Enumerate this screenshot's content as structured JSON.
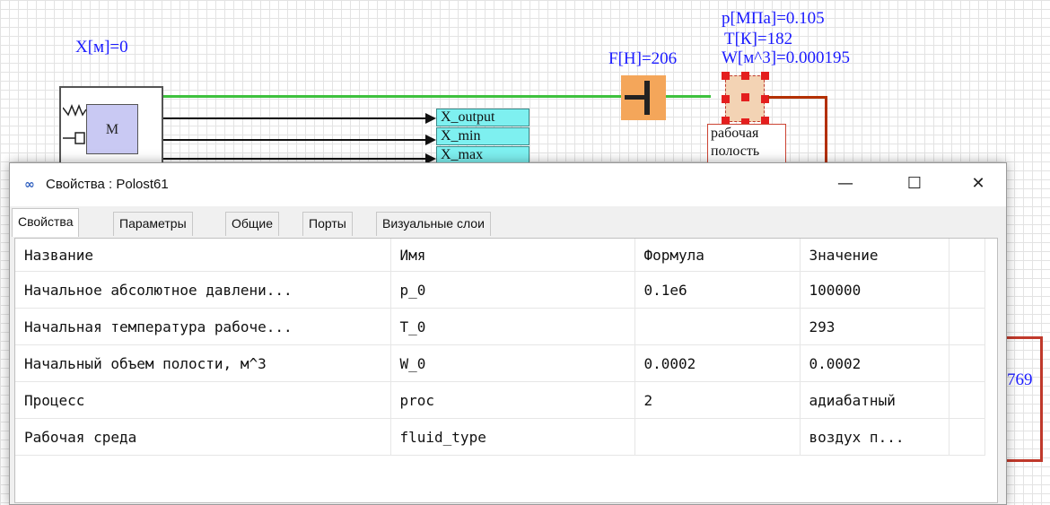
{
  "diagram": {
    "x_label": "X[м]=0",
    "force_label": "F[H]=206",
    "pressure_label": "p[МПа]=0.105",
    "temp_label": "T[К]=182",
    "volume_label": "W[м^3]=0.000195",
    "mass_label": "M",
    "outputs": [
      "X_output",
      "X_min",
      "X_max"
    ],
    "cavity_caption": "рабочая полость",
    "partial_value": "769"
  },
  "window": {
    "title": "Свойства : Polost61",
    "minimize_glyph": "—",
    "maximize_glyph": "☐",
    "close_glyph": "✕"
  },
  "tabs": [
    {
      "label": "Свойства",
      "active": true
    },
    {
      "label": "Параметры",
      "active": false
    },
    {
      "label": "Общие",
      "active": false
    },
    {
      "label": "Порты",
      "active": false
    },
    {
      "label": "Визуальные слои",
      "active": false
    }
  ],
  "table": {
    "headers": [
      "Название",
      "Имя",
      "Формула",
      "Значение"
    ],
    "rows": [
      [
        "Начальное абсолютное давлени...",
        "p_0",
        "0.1e6",
        "100000"
      ],
      [
        "Начальная температура рабоче...",
        "T_0",
        "",
        "293"
      ],
      [
        "Начальный объем полости, м^3",
        "W_0",
        "0.0002",
        "0.0002"
      ],
      [
        "Процесс",
        "proc",
        "2",
        "адиабатный"
      ],
      [
        "Рабочая среда",
        "fluid_type",
        "",
        "воздух п..."
      ]
    ]
  },
  "colors": {
    "label_blue": "#1a1aff",
    "link_green": "#3ec13e",
    "port_cyan": "#7ef0f0",
    "force_orange": "#f4a65a",
    "selection_red": "#e41e1e"
  }
}
